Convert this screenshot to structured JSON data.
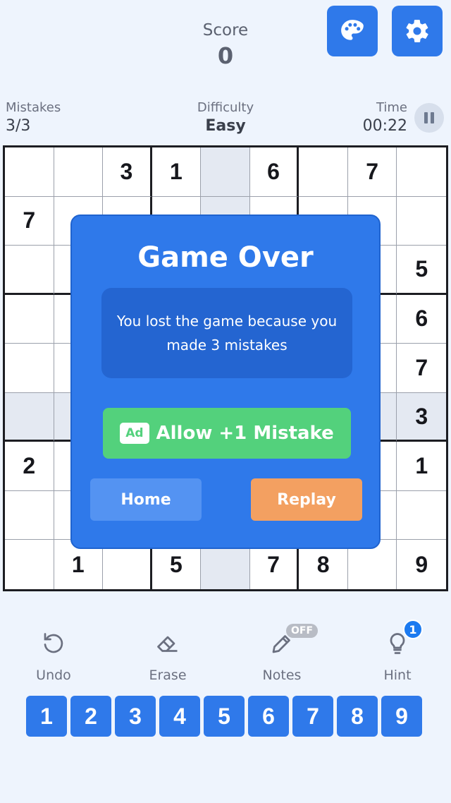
{
  "header": {
    "score_label": "Score",
    "score_value": "0"
  },
  "stats": {
    "mistakes_label": "Mistakes",
    "mistakes_value": "3/3",
    "difficulty_label": "Difficulty",
    "difficulty_value": "Easy",
    "time_label": "Time",
    "time_value": "00:22"
  },
  "board": [
    [
      "",
      "",
      "3",
      "1",
      "",
      "6",
      "",
      "7",
      ""
    ],
    [
      "7",
      "",
      "",
      "",
      "",
      "",
      "",
      "",
      ""
    ],
    [
      "",
      "",
      "",
      "",
      "",
      "",
      "",
      "",
      "5"
    ],
    [
      "",
      "",
      "",
      "",
      "",
      "",
      "",
      "",
      "6"
    ],
    [
      "",
      "",
      "",
      "",
      "",
      "",
      "",
      "",
      "7"
    ],
    [
      "",
      "",
      "",
      "",
      "",
      "",
      "",
      "",
      "3"
    ],
    [
      "2",
      "",
      "",
      "",
      "",
      "",
      "",
      "",
      "1"
    ],
    [
      "",
      "",
      "",
      "",
      "",
      "",
      "",
      "",
      ""
    ],
    [
      "",
      "1",
      "",
      "5",
      "",
      "7",
      "8",
      "",
      "9"
    ]
  ],
  "modal": {
    "title": "Game Over",
    "message": "You lost the game because you made 3 mistakes",
    "ad_badge": "Ad",
    "allow_label": "Allow +1 Mistake",
    "home_label": "Home",
    "replay_label": "Replay"
  },
  "tools": {
    "undo": "Undo",
    "erase": "Erase",
    "notes": "Notes",
    "notes_state": "OFF",
    "hint": "Hint",
    "hint_count": "1"
  },
  "numpad": [
    "1",
    "2",
    "3",
    "4",
    "5",
    "6",
    "7",
    "8",
    "9"
  ],
  "colors": {
    "primary": "#2f79ea",
    "success": "#53d17c",
    "warning": "#f3a061",
    "background": "#eef4fd"
  }
}
